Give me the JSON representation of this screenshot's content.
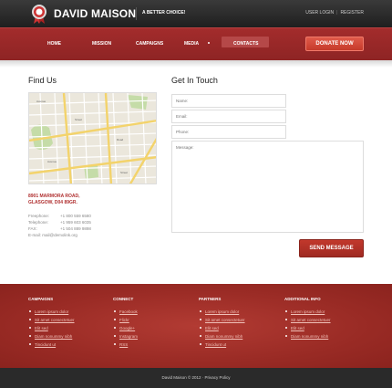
{
  "header": {
    "brand": "DAVID MAISON",
    "tagline": "A BETTER CHOICE!",
    "user_login": "USER LOGIN",
    "register": "REGISTER"
  },
  "nav": {
    "items": [
      "HOME",
      "MISSION",
      "CAMPAIGNS",
      "MEDIA",
      "CONTACTS"
    ],
    "active": "CONTACTS",
    "donate_label": "DONATE NOW"
  },
  "find_us": {
    "title": "Find Us",
    "address_line1": "8901 MARMORA ROAD,",
    "address_line2": "GLASGOW, D04 89GR.",
    "rows": [
      {
        "label": "Freephone:",
        "value": "+1 800 559 6580"
      },
      {
        "label": "Telephone:",
        "value": "+1 959 603 6035"
      },
      {
        "label": "FAX:",
        "value": "+1 504 889 9898"
      }
    ],
    "email_label": "E-mail:",
    "email_value": "mail@demolink.org"
  },
  "contact_form": {
    "title": "Get In Touch",
    "name_placeholder": "Name:",
    "email_placeholder": "Email:",
    "phone_placeholder": "Phone:",
    "message_placeholder": "Message:",
    "send_label": "SEND MESSAGE"
  },
  "footer": {
    "columns": [
      {
        "title": "CAMPAIGNS",
        "items": [
          "Lorem ipsum dolor",
          "Sit amet consectetuer",
          "Elit sed",
          "Diam nonummy nibh",
          "Tincidunt ut"
        ]
      },
      {
        "title": "CONNECT",
        "items": [
          "Facebook",
          "Flickr",
          "Google+",
          "Instagram",
          "RSS"
        ]
      },
      {
        "title": "PARTNERS",
        "items": [
          "Lorem ipsum dolor",
          "Sit amet consectetuer",
          "Elit sed",
          "Diam nonummy nibh",
          "Tincidunt ut"
        ]
      },
      {
        "title": "ADDITIONAL INFO",
        "items": [
          "Lorem ipsum dolor",
          "Sit amet consectetuer",
          "Elit sed",
          "Diam nonummy nibh"
        ]
      }
    ],
    "copyright": "David Maison © 2012 · Privacy Policy"
  },
  "colors": {
    "accent": "#a32c2c",
    "footer": "#9a2b25",
    "topbar": "#2a2a2a"
  }
}
